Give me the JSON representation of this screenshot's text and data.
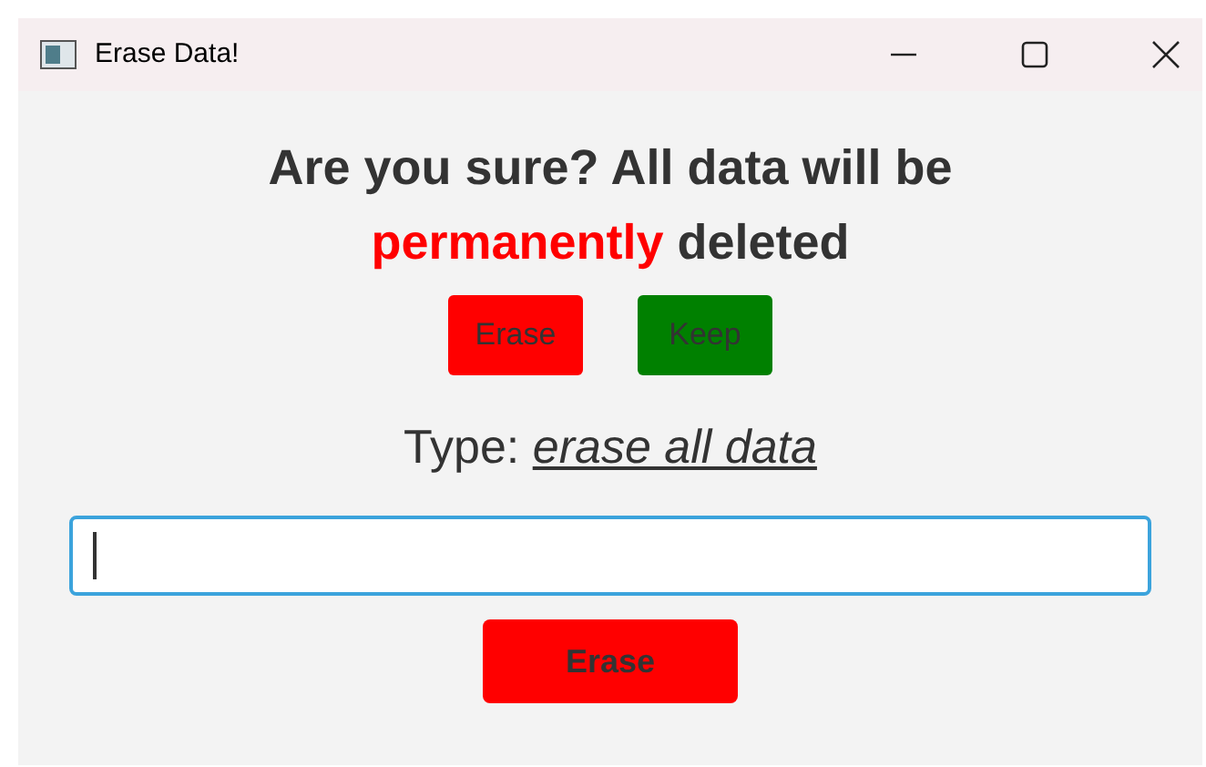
{
  "window": {
    "title": "Erase Data!"
  },
  "heading": {
    "before": "Are you sure? All data will be",
    "emphasis": "permanently",
    "after": "deleted"
  },
  "choice_buttons": [
    {
      "label": "Erase",
      "kind": "danger"
    },
    {
      "label": "Keep",
      "kind": "safe"
    }
  ],
  "prompt": {
    "label": "Type:",
    "phrase": "erase all data"
  },
  "confirm_field": {
    "focused": true
  },
  "submit_button": {
    "label": "Erase"
  }
}
